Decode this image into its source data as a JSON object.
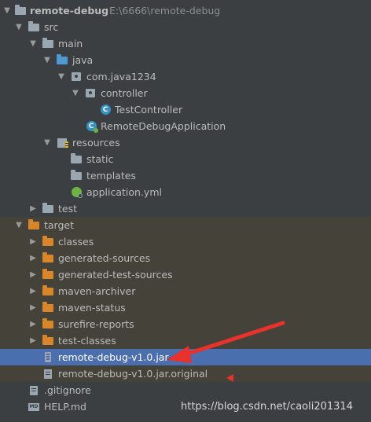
{
  "tree": {
    "root": {
      "label": "remote-debug",
      "path": "E:\\6666\\remote-debug"
    },
    "src": "src",
    "main": "main",
    "java": "java",
    "package": "com.java1234",
    "controller": "controller",
    "test_controller": "TestController",
    "remote_debug_application": "RemoteDebugApplication",
    "resources": "resources",
    "static": "static",
    "templates": "templates",
    "application_yml": "application.yml",
    "test": "test",
    "target": "target",
    "target_children": [
      "classes",
      "generated-sources",
      "generated-test-sources",
      "maven-archiver",
      "maven-status",
      "surefire-reports",
      "test-classes"
    ],
    "jar": "remote-debug-v1.0.jar",
    "jar_original": "remote-debug-v1.0.jar.original",
    "gitignore": ".gitignore",
    "help_md": "HELP.md"
  },
  "watermark": "https://blog.csdn.net/caoli201314",
  "colors": {
    "background": "#3c3f41",
    "selection": "#4b6eaf",
    "target_band": "#45423a",
    "annotation_arrow": "#e8322b"
  }
}
